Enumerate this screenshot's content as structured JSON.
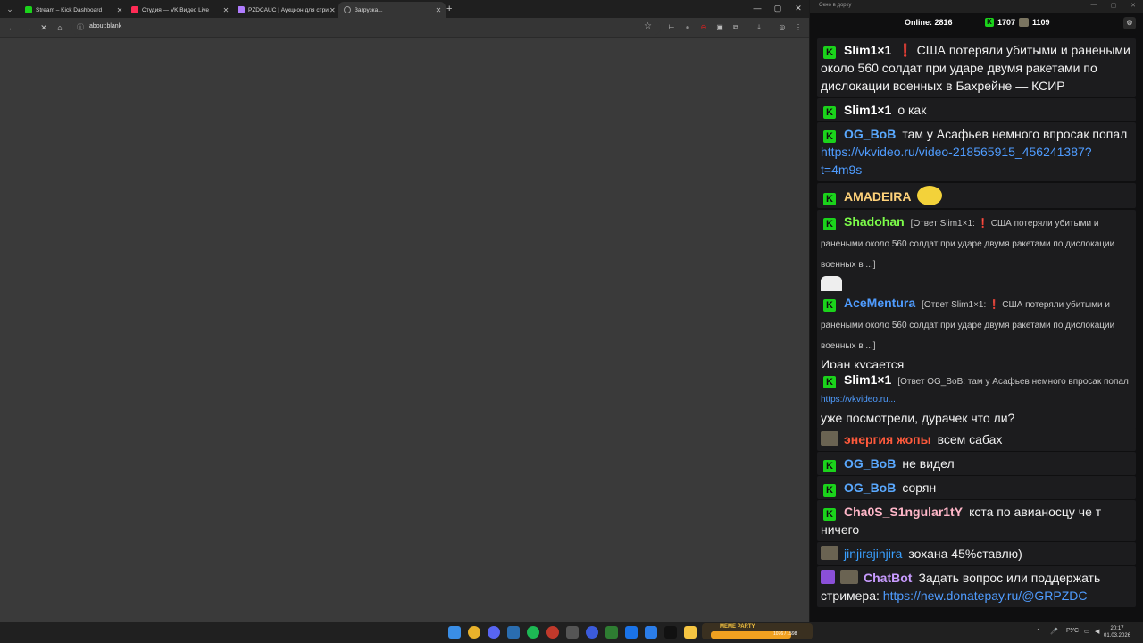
{
  "browser": {
    "tabs": [
      {
        "label": "Stream – Kick Dashboard",
        "color": "#1bd31b"
      },
      {
        "label": "Студия — VK Видео Live",
        "color": "#ff2b55"
      },
      {
        "label": "PZDCAUC | Аукцион для стри...",
        "color": "#b07cff"
      },
      {
        "label": "Загрузка...",
        "color": "#888888"
      }
    ],
    "url": "about:blank"
  },
  "chat": {
    "title": "Окно в дорку",
    "online_label": "Online:",
    "online_count": "2816",
    "kick_viewers": "1707",
    "other_viewers": "1109",
    "messages": [
      {
        "user": "Slim1×1",
        "color": "#ffffff",
        "badge": "kick",
        "text": "❗ США потеряли убитыми и ранеными около 560 солдат при ударе двумя ракетами по дислокации военных в Бахрейне — КСИР"
      },
      {
        "user": "Slim1×1",
        "color": "#ffffff",
        "badge": "kick",
        "text": "о как"
      },
      {
        "user": "OG_BoB",
        "color": "#5aa9ff",
        "badge": "kick",
        "text": "там у Асафьев немного впросак попал",
        "link": "https://vkvideo.ru/video-218565915_456241387?t=4m9s"
      },
      {
        "user": "AMADEIRA",
        "color": "#ffd27a",
        "badge": "kick",
        "text": ""
      },
      {
        "user": "Shadohan",
        "color": "#7cfc4a",
        "badge": "kick",
        "reply": "[Ответ Slim1×1: ❗ США потеряли убитыми и ранеными около 560 солдат при ударе двумя ракетами по дислокации военных в ...]",
        "text": ""
      },
      {
        "user": "AceMentura",
        "color": "#4f9cff",
        "badge": "kick",
        "reply": "[Ответ Slim1×1: ❗ США потеряли убитыми и ранеными около 560 солдат при ударе двумя ракетами по дислокации военных в ...]",
        "text": "Иран кусается"
      },
      {
        "user": "Slim1×1",
        "color": "#ffffff",
        "badge": "kick",
        "reply": "[Ответ OG_BoB: там у Асафьев немного впросак попал",
        "reply_link": "https://vkvideo.ru...",
        "text": "уже посмотрели, дурачек что ли?"
      },
      {
        "user": "энергия жопы",
        "color": "#ff5a3c",
        "badge": "img",
        "text": "всем сабах"
      },
      {
        "user": "OG_BoB",
        "color": "#5aa9ff",
        "badge": "kick",
        "text": "не видел"
      },
      {
        "user": "OG_BoB",
        "color": "#5aa9ff",
        "badge": "kick",
        "text": "сорян"
      },
      {
        "user": "Cha0S_S1ngular1tY",
        "color": "#ffb6c8",
        "badge": "kick",
        "text": "кста по авианосцу че т ничего"
      },
      {
        "user": "jinjirajinjira",
        "color": "#3aa0ff",
        "badge": "img",
        "text": "зохана 45%ставлю)"
      },
      {
        "user": "ChatBot",
        "color": "#c89bff",
        "badge": "bot",
        "text": "Задать вопрос или поддержать стримера:",
        "link": "https://new.donatepay.ru/@GRPZDC"
      }
    ]
  },
  "taskbar": {
    "media_title": "MEME PARTY",
    "media_value": "1076 / 1598",
    "lang": "РУС",
    "time": "20:17",
    "date": "01.03.2026"
  }
}
